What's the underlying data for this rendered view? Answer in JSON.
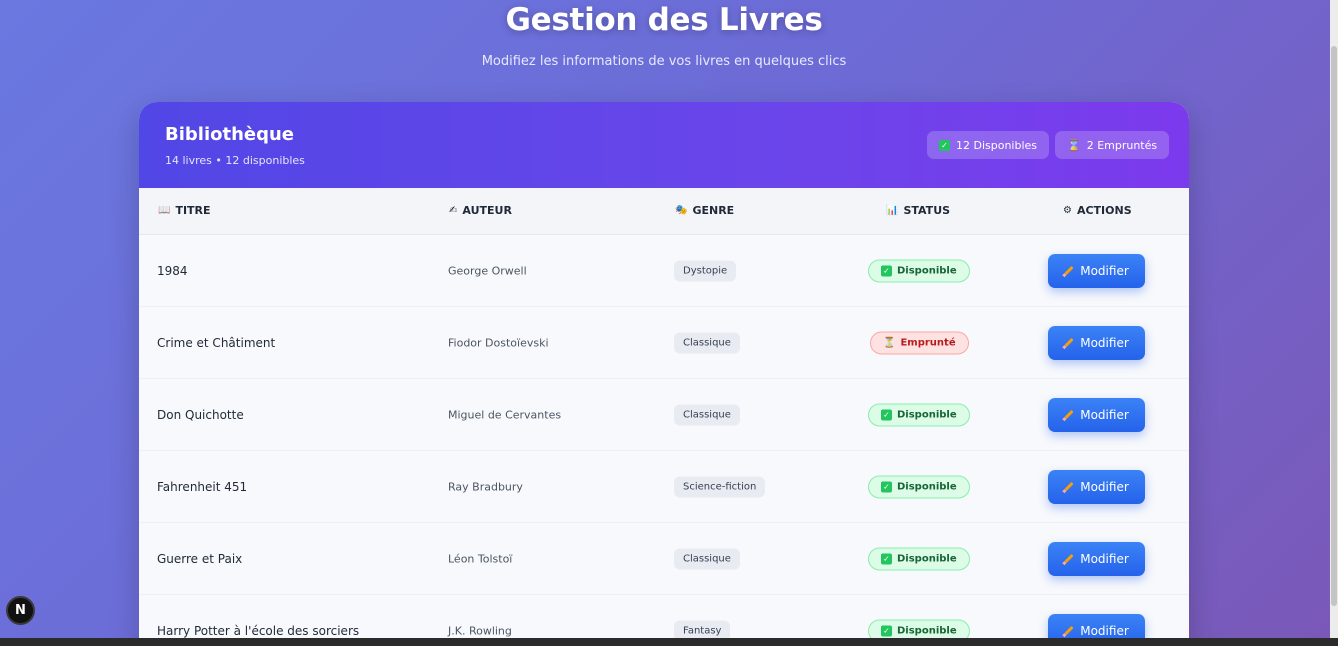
{
  "header": {
    "title": "Gestion des Livres",
    "subtitle": "Modifiez les informations de vos livres en quelques clics"
  },
  "library": {
    "title": "Bibliothèque",
    "meta": "14 livres • 12 disponibles",
    "chip_available": "12 Disponibles",
    "chip_borrowed": "2 Empruntés"
  },
  "columns": {
    "title": "TITRE",
    "author": "AUTEUR",
    "genre": "GENRE",
    "status": "STATUS",
    "actions": "ACTIONS"
  },
  "books": [
    {
      "title": "1984",
      "author": "George Orwell",
      "genre": "Dystopie",
      "status": "Disponible",
      "action": "Modifier"
    },
    {
      "title": "Crime et Châtiment",
      "author": "Fiodor Dostoïevski",
      "genre": "Classique",
      "status": "Emprunté",
      "action": "Modifier"
    },
    {
      "title": "Don Quichotte",
      "author": "Miguel de Cervantes",
      "genre": "Classique",
      "status": "Disponible",
      "action": "Modifier"
    },
    {
      "title": "Fahrenheit 451",
      "author": "Ray Bradbury",
      "genre": "Science-fiction",
      "status": "Disponible",
      "action": "Modifier"
    },
    {
      "title": "Guerre et Paix",
      "author": "Léon Tolstoï",
      "genre": "Classique",
      "status": "Disponible",
      "action": "Modifier"
    },
    {
      "title": "Harry Potter à l'école des sorciers",
      "author": "J.K. Rowling",
      "genre": "Fantasy",
      "status": "Disponible",
      "action": "Modifier"
    }
  ],
  "badge": "N",
  "colors": {
    "accent": "#2563eb",
    "header_gradient_start": "#5147e6",
    "header_gradient_end": "#7c3aed",
    "available": "#166534",
    "borrowed": "#b91c1c"
  }
}
